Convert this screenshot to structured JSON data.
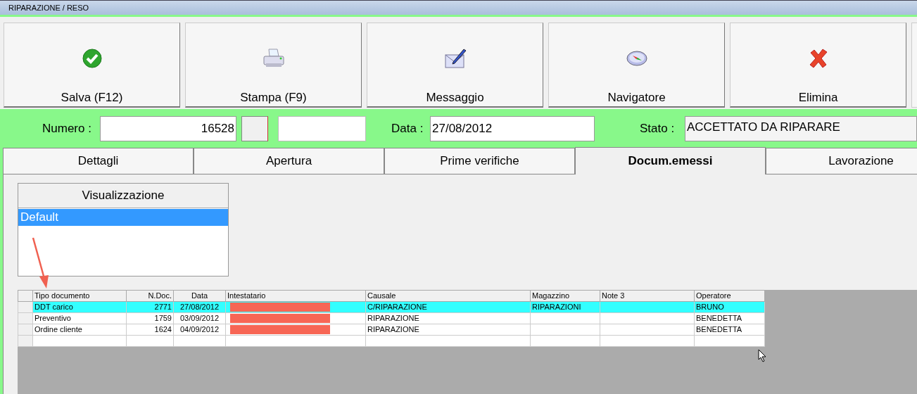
{
  "window": {
    "title": "RIPARAZIONE / RESO"
  },
  "toolbar": [
    {
      "label": "Salva (F12)"
    },
    {
      "label": "Stampa (F9)"
    },
    {
      "label": "Messaggio"
    },
    {
      "label": "Navigatore"
    },
    {
      "label": "Elimina"
    }
  ],
  "header": {
    "numero_label": "Numero :",
    "numero": "16528",
    "data_label": "Data :",
    "data": "27/08/2012",
    "stato_label": "Stato :",
    "stato": "ACCETTATO DA RIPARARE"
  },
  "tabs": [
    {
      "label": "Dettagli",
      "selected": false
    },
    {
      "label": "Apertura",
      "selected": false
    },
    {
      "label": "Prime verifiche",
      "selected": false
    },
    {
      "label": "Docum.emessi",
      "selected": true
    },
    {
      "label": "Lavorazione",
      "selected": false
    }
  ],
  "view_list": {
    "title": "Visualizzazione",
    "items": [
      {
        "label": "Default",
        "selected": true
      }
    ]
  },
  "table": {
    "columns": [
      "Tipo documento",
      "N.Doc.",
      "Data",
      "Intestatario",
      "Causale",
      "Magazzino",
      "Note 3",
      "Operatore"
    ],
    "rows": [
      {
        "selected": true,
        "cells": [
          "DDT carico",
          "2771",
          "27/08/2012",
          {
            "redacted": true
          },
          "C/RIPARAZIONE",
          "RIPARAZIONI",
          "",
          "BRUNO"
        ]
      },
      {
        "selected": false,
        "cells": [
          "Preventivo",
          "1759",
          "03/09/2012",
          {
            "redacted": true
          },
          "RIPARAZIONE",
          "",
          "",
          "BENEDETTA"
        ]
      },
      {
        "selected": false,
        "cells": [
          "Ordine cliente",
          "1624",
          "04/09/2012",
          {
            "redacted": true
          },
          "RIPARAZIONE",
          "",
          "",
          "BENEDETTA"
        ]
      }
    ]
  }
}
